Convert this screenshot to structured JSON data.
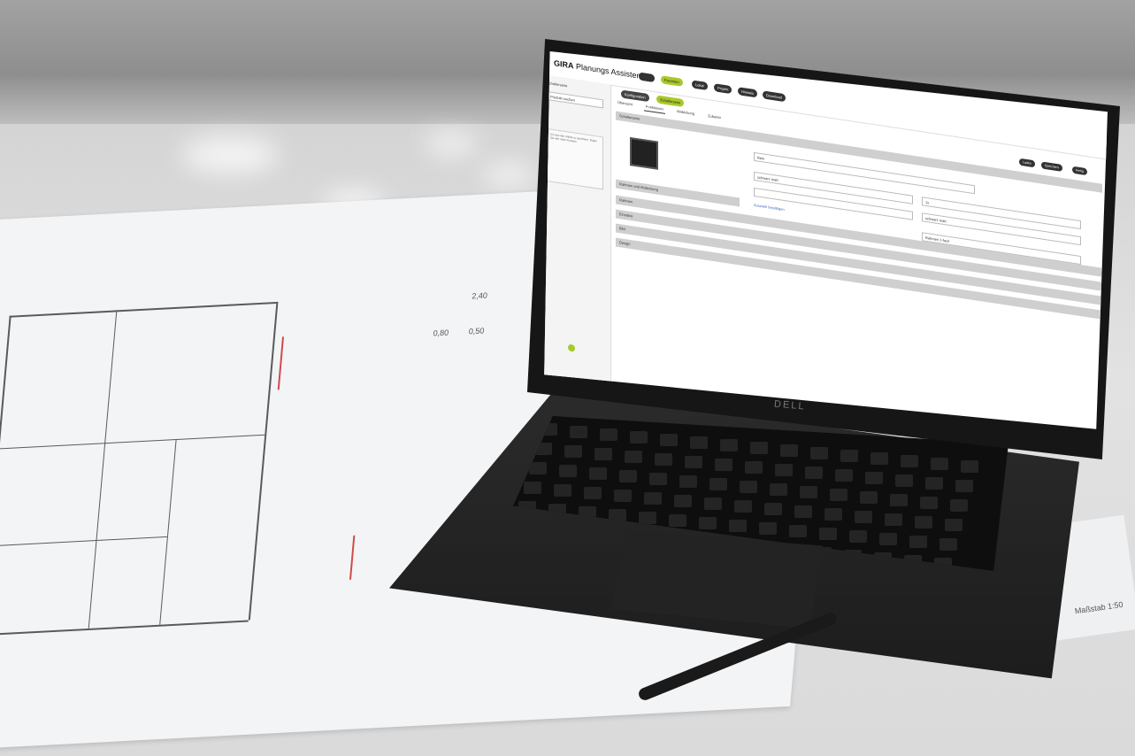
{
  "scene": {
    "laptop_brand": "DELL",
    "colors": {
      "accent": "#a8c92b",
      "dark": "#222222",
      "desk": "#dedede"
    }
  },
  "app": {
    "brand_bold": "GIRA",
    "brand_rest": " Planungs Assistent",
    "header_pills": [
      "",
      "Favoriten",
      "Lokal",
      "Projekt",
      "Hinweis",
      "Download"
    ],
    "right_buttons": [
      "Laden",
      "Speichern",
      "Fertig"
    ],
    "sidebar_title": "Schalterserie",
    "sidebar_search": "Produkt suchen",
    "sidebar_note": "Um das den Artikel zu speichern, folgen Sie den roten Punkten.",
    "steps": [
      "Konfiguration",
      "Schalterserie"
    ],
    "tabs": [
      "Übersicht",
      "Funktionen",
      "Abdeckung",
      "Zubehör"
    ],
    "sections": [
      "Schalterserie",
      "Rahmen und Abdeckung",
      "Rahmen",
      "Einsätze",
      "Bild",
      "Design"
    ],
    "fields": {
      "name_label": "Artikel",
      "name_value": "Rein",
      "series_value": "schwarz matt",
      "count_value": "1x",
      "color_value": "schwarz matt",
      "material_value": "Rahmen 1-fach"
    },
    "link": "Auswahl bestätigen"
  },
  "blueprint": {
    "labels": [
      "2,40",
      "0,80",
      "0,50",
      "Maßstab 1:50"
    ]
  }
}
